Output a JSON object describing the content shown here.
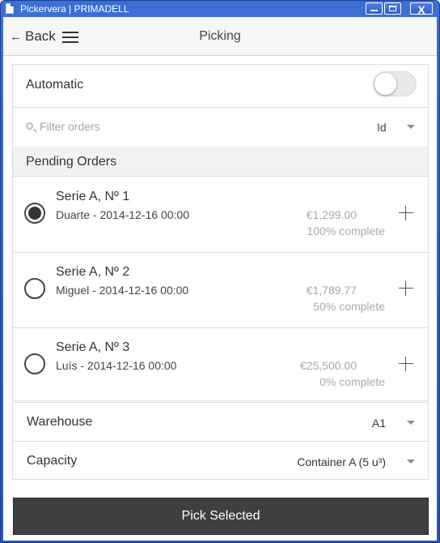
{
  "window": {
    "title": "Pickervera | PRIMADELL",
    "close_glyph": "X"
  },
  "header": {
    "back_label": "Back",
    "back_arrow": "←",
    "title": "Picking"
  },
  "automatic": {
    "label": "Automatic",
    "enabled": false
  },
  "filter": {
    "placeholder": "Filter orders",
    "value": "",
    "sort_by": "Id"
  },
  "pending": {
    "label": "Pending Orders",
    "orders": [
      {
        "title": "Serie A, Nº 1",
        "subtitle": "Duarte - 2014-12-16 00:00",
        "amount": "€1,299.00",
        "progress": "100% complete",
        "selected": true
      },
      {
        "title": "Serie A, Nº 2",
        "subtitle": "Miguel - 2014-12-16 00:00",
        "amount": "€1,789.77",
        "progress": "50% complete",
        "selected": false
      },
      {
        "title": "Serie A, Nº 3",
        "subtitle": "Luís - 2014-12-16 00:00",
        "amount": "€25,500.00",
        "progress": "0% complete",
        "selected": false
      }
    ]
  },
  "warehouse": {
    "label": "Warehouse",
    "value": "A1"
  },
  "capacity": {
    "label": "Capacity",
    "value": "Container A (5 u³)"
  },
  "actions": {
    "pick_label": "Pick Selected"
  },
  "colors": {
    "titlebar": "#3c6fd6",
    "button": "#3f3f3f",
    "section_bg": "#f2f2f2"
  }
}
